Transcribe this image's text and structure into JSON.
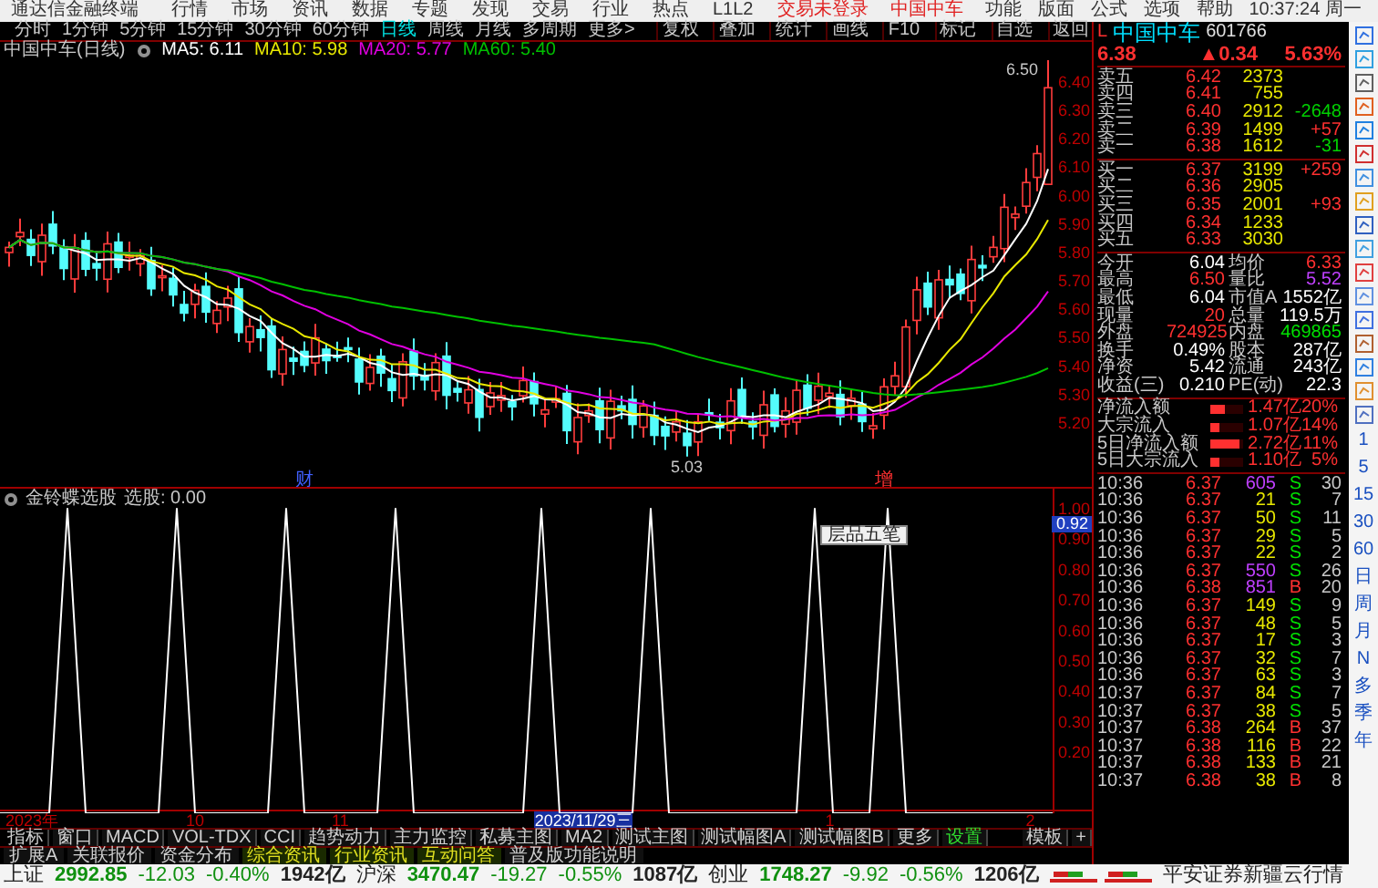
{
  "app": {
    "title": "通达信金融终端",
    "menu": [
      "行情",
      "市场",
      "资讯",
      "数据",
      "专题",
      "发现",
      "交易",
      "行业",
      "热点",
      "L1L2"
    ],
    "login_status": "交易未登录",
    "stock_tab": "中国中车",
    "tools": [
      "功能",
      "版面",
      "公式",
      "选项",
      "帮助"
    ],
    "clock": "10:37:24 周一"
  },
  "periods": [
    {
      "label": "分时",
      "selected": false
    },
    {
      "label": "1分钟",
      "selected": false
    },
    {
      "label": "5分钟",
      "selected": false
    },
    {
      "label": "15分钟",
      "selected": false
    },
    {
      "label": "30分钟",
      "selected": false
    },
    {
      "label": "60分钟",
      "selected": false
    },
    {
      "label": "日线",
      "selected": true
    },
    {
      "label": "周线",
      "selected": false
    },
    {
      "label": "月线",
      "selected": false
    },
    {
      "label": "多周期",
      "selected": false
    },
    {
      "label": "更多>",
      "selected": false
    }
  ],
  "chart_tools": [
    "复权",
    "叠加",
    "统计",
    "画线",
    "F10",
    "标记",
    "自选",
    "返回"
  ],
  "main_chart": {
    "title": "中国中车(日线)",
    "ma": [
      {
        "label": "MA5: 6.11",
        "color": "#ffffff"
      },
      {
        "label": "MA10: 5.98",
        "color": "#e8e800"
      },
      {
        "label": "MA20: 5.77",
        "color": "#e000e0"
      },
      {
        "label": "MA60: 5.40",
        "color": "#00c000"
      }
    ],
    "price_axis": [
      "6.40",
      "6.30",
      "6.20",
      "6.10",
      "6.00",
      "5.90",
      "5.80",
      "5.70",
      "5.60",
      "5.50",
      "5.40",
      "5.30",
      "5.20"
    ],
    "high_label": "6.50",
    "low_label": "5.03",
    "events": [
      {
        "label": "财",
        "color": "#4060ff"
      },
      {
        "label": "增",
        "color": "#ff3030"
      }
    ]
  },
  "indicator": {
    "title": "金铃蝶选股",
    "reading": "选股: 0.00",
    "cursor_value": "0.92",
    "float_toolbar": "层品五笔",
    "axis_labels": [
      "1.00",
      "0.90",
      "0.80",
      "0.70",
      "0.60",
      "0.50",
      "0.40",
      "0.30",
      "0.20"
    ]
  },
  "date_axis": [
    {
      "label": "2023年",
      "selected": false
    },
    {
      "label": "10",
      "selected": false
    },
    {
      "label": "11",
      "selected": false
    },
    {
      "label": "2023/11/29三",
      "selected": true
    },
    {
      "label": "1",
      "selected": false
    },
    {
      "label": "2",
      "selected": false
    }
  ],
  "indicator_tabs": [
    {
      "label": "指标",
      "kind": "caption"
    },
    {
      "label": "窗口",
      "kind": "tab"
    },
    {
      "label": "MACD",
      "kind": "tab"
    },
    {
      "label": "VOL-TDX",
      "kind": "tab"
    },
    {
      "label": "CCI",
      "kind": "tab"
    },
    {
      "label": "趋势动力",
      "kind": "tab"
    },
    {
      "label": "主力监控",
      "kind": "tab"
    },
    {
      "label": "私募主图",
      "kind": "tab"
    },
    {
      "label": "MA2",
      "kind": "tab"
    },
    {
      "label": "测试主图",
      "kind": "tab"
    },
    {
      "label": "测试幅图A",
      "kind": "tab"
    },
    {
      "label": "测试幅图B",
      "kind": "tab"
    },
    {
      "label": "更多",
      "kind": "tab"
    },
    {
      "label": "设置",
      "kind": "accent"
    }
  ],
  "template_controls": [
    "模板",
    "+"
  ],
  "info_tabs": [
    {
      "label": "扩展A",
      "highlight": false
    },
    {
      "label": "关联报价",
      "highlight": false
    },
    {
      "label": "资金分布",
      "highlight": false
    },
    {
      "label": "综合资讯",
      "highlight": true
    },
    {
      "label": "行业资讯",
      "highlight": true
    },
    {
      "label": "互动问答",
      "highlight": true
    },
    {
      "label": "普及版功能说明",
      "highlight": false
    }
  ],
  "quote": {
    "marker": "L",
    "name": "中国中车",
    "code": "601766",
    "price": "6.38",
    "change": "▲0.34",
    "percent": "5.63%",
    "asks": [
      {
        "label": "卖五",
        "price": "6.42",
        "volume": "2373"
      },
      {
        "label": "卖四",
        "price": "6.41",
        "volume": "755"
      },
      {
        "label": "卖三",
        "price": "6.40",
        "volume": "2912",
        "delta": "-2648",
        "color": "#00d000"
      },
      {
        "label": "卖二",
        "price": "6.39",
        "volume": "1499",
        "delta": "+57",
        "color": "#ff3030"
      },
      {
        "label": "卖一",
        "price": "6.38",
        "volume": "1612",
        "delta": "-31",
        "color": "#00d000"
      }
    ],
    "bids": [
      {
        "label": "买一",
        "price": "6.37",
        "volume": "3199",
        "delta": "+259",
        "color": "#ff3030"
      },
      {
        "label": "买二",
        "price": "6.36",
        "volume": "2905"
      },
      {
        "label": "买三",
        "price": "6.35",
        "volume": "2001",
        "delta": "+93",
        "color": "#ff3030"
      },
      {
        "label": "买四",
        "price": "6.34",
        "volume": "1233"
      },
      {
        "label": "买五",
        "price": "6.33",
        "volume": "3030"
      }
    ],
    "stats": [
      {
        "left": {
          "label": "今开",
          "value": "6.04",
          "color": "#ffffff"
        },
        "right": {
          "label": "均价",
          "value": "6.33",
          "color": "#ff3030"
        }
      },
      {
        "left": {
          "label": "最高",
          "value": "6.50",
          "color": "#ff3030"
        },
        "right": {
          "label": "量比",
          "value": "5.52",
          "color": "#c040ff"
        }
      },
      {
        "left": {
          "label": "最低",
          "value": "6.04",
          "color": "#ffffff"
        },
        "right": {
          "label": "市值A",
          "value": "1552亿",
          "color": "#ffffff"
        }
      },
      {
        "left": {
          "label": "现量",
          "value": "20",
          "color": "#ff3030"
        },
        "right": {
          "label": "总量",
          "value": "119.5万",
          "color": "#ffffff"
        }
      },
      {
        "left": {
          "label": "外盘",
          "value": "724925",
          "color": "#ff3030"
        },
        "right": {
          "label": "内盘",
          "value": "469865",
          "color": "#00e000"
        }
      },
      {
        "left": {
          "label": "换手",
          "value": "0.49%",
          "color": "#ffffff"
        },
        "right": {
          "label": "股本",
          "value": "287亿",
          "color": "#ffffff"
        }
      },
      {
        "left": {
          "label": "净资",
          "value": "5.42",
          "color": "#ffffff"
        },
        "right": {
          "label": "流通",
          "value": "243亿",
          "color": "#ffffff"
        }
      },
      {
        "left": {
          "label": "收益(三)",
          "value": "0.210",
          "color": "#ffffff"
        },
        "right": {
          "label": "PE(动)",
          "value": "22.3",
          "color": "#ffffff"
        }
      }
    ],
    "flows": [
      {
        "label": "净流入额",
        "level": 0.45,
        "value": "1.47亿",
        "percent": "20%"
      },
      {
        "label": "大宗流入",
        "level": 0.3,
        "value": "1.07亿",
        "percent": "14%"
      },
      {
        "label": "5日净流入额",
        "level": 0.9,
        "value": "2.72亿",
        "percent": "11%"
      },
      {
        "label": "5日大宗流入",
        "level": 0.3,
        "value": "1.10亿",
        "percent": "5%"
      }
    ]
  },
  "ticks": [
    {
      "time": "10:36",
      "price": "6.37",
      "volume": "605",
      "side": "S",
      "count": "30",
      "kind": "sell",
      "large": true
    },
    {
      "time": "10:36",
      "price": "6.37",
      "volume": "21",
      "side": "S",
      "count": "7",
      "kind": "sell",
      "large": false
    },
    {
      "time": "10:36",
      "price": "6.37",
      "volume": "50",
      "side": "S",
      "count": "11",
      "kind": "sell",
      "large": false
    },
    {
      "time": "10:36",
      "price": "6.37",
      "volume": "29",
      "side": "S",
      "count": "5",
      "kind": "sell",
      "large": false
    },
    {
      "time": "10:36",
      "price": "6.37",
      "volume": "22",
      "side": "S",
      "count": "2",
      "kind": "sell",
      "large": false
    },
    {
      "time": "10:36",
      "price": "6.37",
      "volume": "550",
      "side": "S",
      "count": "26",
      "kind": "sell",
      "large": true
    },
    {
      "time": "10:36",
      "price": "6.38",
      "volume": "851",
      "side": "B",
      "count": "20",
      "kind": "buy",
      "large": true
    },
    {
      "time": "10:36",
      "price": "6.37",
      "volume": "149",
      "side": "S",
      "count": "9",
      "kind": "sell",
      "large": false
    },
    {
      "time": "10:36",
      "price": "6.37",
      "volume": "48",
      "side": "S",
      "count": "5",
      "kind": "sell",
      "large": false
    },
    {
      "time": "10:36",
      "price": "6.37",
      "volume": "17",
      "side": "S",
      "count": "3",
      "kind": "sell",
      "large": false
    },
    {
      "time": "10:36",
      "price": "6.37",
      "volume": "32",
      "side": "S",
      "count": "7",
      "kind": "sell",
      "large": false
    },
    {
      "time": "10:36",
      "price": "6.37",
      "volume": "63",
      "side": "S",
      "count": "3",
      "kind": "sell",
      "large": false
    },
    {
      "time": "10:37",
      "price": "6.37",
      "volume": "84",
      "side": "S",
      "count": "7",
      "kind": "sell",
      "large": false
    },
    {
      "time": "10:37",
      "price": "6.37",
      "volume": "38",
      "side": "S",
      "count": "5",
      "kind": "sell",
      "large": false
    },
    {
      "time": "10:37",
      "price": "6.38",
      "volume": "264",
      "side": "B",
      "count": "37",
      "kind": "buy",
      "large": false
    },
    {
      "time": "10:37",
      "price": "6.38",
      "volume": "116",
      "side": "B",
      "count": "22",
      "kind": "buy",
      "large": false
    },
    {
      "time": "10:37",
      "price": "6.38",
      "volume": "133",
      "side": "B",
      "count": "21",
      "kind": "buy",
      "large": false
    },
    {
      "time": "10:37",
      "price": "6.38",
      "volume": "38",
      "side": "B",
      "count": "8",
      "kind": "buy",
      "large": false
    }
  ],
  "side_periods": [
    "1",
    "5",
    "15",
    "30",
    "60",
    "日",
    "周",
    "月",
    "N",
    "多",
    "季",
    "年"
  ],
  "status_bar": {
    "indices": [
      {
        "name": "上证",
        "value": "2992.85",
        "change": "-12.03",
        "percent": "-0.40%",
        "amount": "1942亿"
      },
      {
        "name": "沪深",
        "value": "3470.47",
        "change": "-19.27",
        "percent": "-0.55%",
        "amount": "1087亿"
      },
      {
        "name": "创业",
        "value": "1748.27",
        "change": "-9.92",
        "percent": "-0.56%",
        "amount": "1206亿"
      }
    ],
    "broker": "平安证券新疆云行情"
  }
}
